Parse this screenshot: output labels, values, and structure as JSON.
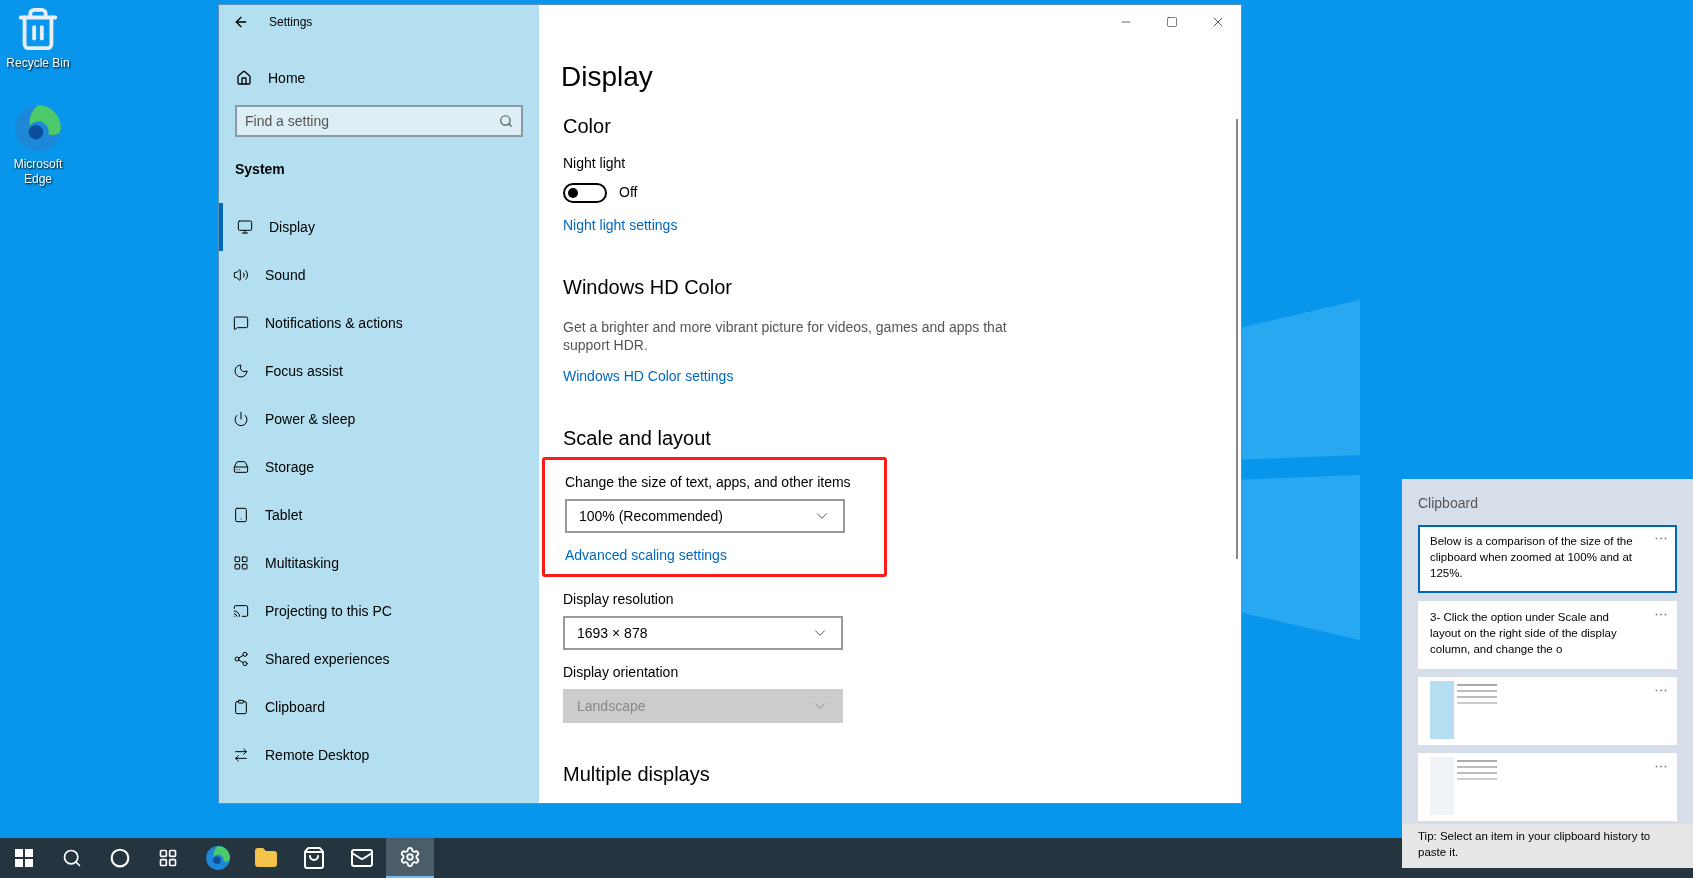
{
  "desktop_icons": [
    {
      "kind": "recycle",
      "label": "Recycle Bin"
    },
    {
      "kind": "edge",
      "label": "Microsoft Edge"
    }
  ],
  "settings": {
    "title": "Settings",
    "home": "Home",
    "search": {
      "placeholder": "Find a setting"
    },
    "section": "System",
    "items": [
      {
        "label": "Display",
        "selected": true
      },
      {
        "label": "Sound",
        "selected": false
      },
      {
        "label": "Notifications & actions",
        "selected": false
      },
      {
        "label": "Focus assist",
        "selected": false
      },
      {
        "label": "Power & sleep",
        "selected": false
      },
      {
        "label": "Storage",
        "selected": false
      },
      {
        "label": "Tablet",
        "selected": false
      },
      {
        "label": "Multitasking",
        "selected": false
      },
      {
        "label": "Projecting to this PC",
        "selected": false
      },
      {
        "label": "Shared experiences",
        "selected": false
      },
      {
        "label": "Clipboard",
        "selected": false
      },
      {
        "label": "Remote Desktop",
        "selected": false
      }
    ],
    "page_title": "Display",
    "sections": [
      {
        "heading": "Color",
        "blocks": [
          {
            "kind": "label",
            "text": "Night light"
          },
          {
            "kind": "toggle",
            "on": false,
            "text": "Off"
          },
          {
            "kind": "link",
            "text": "Night light settings"
          }
        ]
      },
      {
        "heading": "Windows HD Color",
        "blocks": [
          {
            "kind": "text",
            "text": "Get a brighter and more vibrant picture for videos, games and apps that support HDR."
          },
          {
            "kind": "link",
            "text": "Windows HD Color settings"
          }
        ]
      },
      {
        "heading": "Scale and layout",
        "blocks": [
          {
            "kind": "group",
            "highlighted": true,
            "blocks": [
              {
                "kind": "label",
                "text": "Change the size of text, apps, and other items"
              },
              {
                "kind": "dropdown",
                "value": "100% (Recommended)",
                "disabled": false
              },
              {
                "kind": "link",
                "text": "Advanced scaling settings"
              }
            ]
          },
          {
            "kind": "label",
            "text": "Display resolution"
          },
          {
            "kind": "dropdown",
            "value": "1693 × 878",
            "disabled": false
          },
          {
            "kind": "label",
            "text": "Display orientation"
          },
          {
            "kind": "dropdown",
            "value": "Landscape",
            "disabled": true
          }
        ]
      },
      {
        "heading": "Multiple displays"
      }
    ]
  },
  "clipboard": {
    "title": "Clipboard",
    "items": [
      {
        "kind": "text",
        "text": "Below is a comparison of the size of the clipboard when zoomed at 100% and at 125%.",
        "selected": true
      },
      {
        "kind": "text",
        "text": "3- Click the option under Scale and layout on the right side of the display column, and change the o",
        "selected": false
      },
      {
        "kind": "image",
        "selected": false
      },
      {
        "kind": "image",
        "selected": false
      }
    ],
    "tip": "Tip: Select an item in your clipboard history to paste it."
  },
  "taskbar": [
    {
      "kind": "start",
      "selected": false
    },
    {
      "kind": "search",
      "selected": false
    },
    {
      "kind": "cortana",
      "selected": false
    },
    {
      "kind": "taskview",
      "selected": false
    },
    {
      "kind": "edge",
      "selected": false
    },
    {
      "kind": "explorer",
      "selected": false
    },
    {
      "kind": "store",
      "selected": false
    },
    {
      "kind": "mail",
      "selected": false
    },
    {
      "kind": "settings",
      "selected": true
    }
  ]
}
